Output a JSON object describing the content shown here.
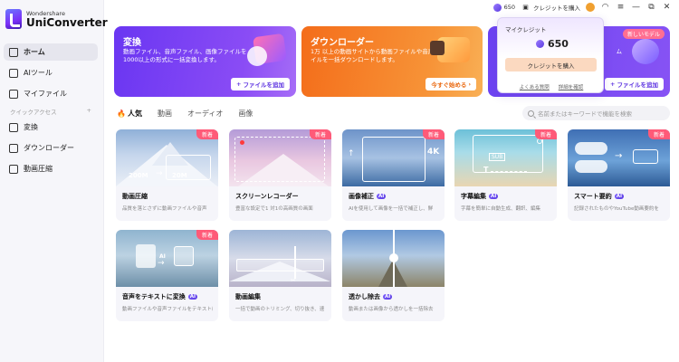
{
  "app": {
    "brand_small": "Wondershare",
    "brand_name": "UniConverter"
  },
  "sidebar": {
    "items": [
      {
        "label": "ホーム",
        "icon": "home-icon",
        "active": true
      },
      {
        "label": "AIツール",
        "icon": "ai-tools-icon"
      },
      {
        "label": "マイファイル",
        "icon": "my-files-icon"
      }
    ],
    "quick_access": "クイックアクセス",
    "quick_items": [
      {
        "label": "変換",
        "icon": "convert-icon"
      },
      {
        "label": "ダウンローダー",
        "icon": "downloader-icon"
      },
      {
        "label": "動画圧縮",
        "icon": "compress-icon"
      }
    ]
  },
  "titlebar": {
    "credits": "650",
    "buy_label": "クレジットを購入"
  },
  "banners": [
    {
      "title": "変換",
      "desc": "動画ファイル、音声ファイル、画像ファイルを1000以上の形式に一括変換します。",
      "button": "ファイルを追加"
    },
    {
      "title": "ダウンローダー",
      "desc": "1万 以上の動画サイトから動画ファイルや音声ファイルを一括ダウンロードします。",
      "button": "今すぐ始める"
    },
    {
      "title": "",
      "badge": "新しいモデル",
      "desc_tail": "ム",
      "button": "ファイルを追加"
    }
  ],
  "credit_popup": {
    "title": "マイクレジット",
    "value": "650",
    "buy_button": "クレジットを購入",
    "links": [
      "よくある質問",
      "詳細を確認"
    ]
  },
  "tabs": [
    "人気",
    "動画",
    "オーディオ",
    "画像"
  ],
  "search": {
    "placeholder": "名前またはキーワードで機能を検索"
  },
  "cards": [
    {
      "title": "動画圧縮",
      "desc": "品質を落とさずに動画ファイルや音声",
      "badge_new": "新着",
      "ai": false
    },
    {
      "title": "スクリーンレコーダー",
      "desc": "豊富な設定で1 対1の高画質の画面",
      "badge_new": "新着",
      "ai": false
    },
    {
      "title": "画像補正",
      "desc": "AIを使用して画像を一括で補正し、鮮",
      "badge_new": "新着",
      "ai": true
    },
    {
      "title": "字幕編集",
      "desc": "字幕を簡単に自動生成、翻訳、編集",
      "badge_new": "新着",
      "ai": true
    },
    {
      "title": "スマート要約",
      "desc": "記録されたものやYouTube動画要約を",
      "badge_new": "新着",
      "ai": true
    },
    {
      "title": "音声をテキストに変換",
      "desc": "動画ファイルや音声ファイルをテキストに",
      "badge_new": "新着",
      "ai": true
    },
    {
      "title": "動画編集",
      "desc": "一括で動画のトリミング、切り抜き、速",
      "badge_new": "",
      "ai": false
    },
    {
      "title": "透かし除去",
      "desc": "動画または画像から透かしを一括除去",
      "badge_new": "",
      "ai": true
    }
  ],
  "thumb_text": {
    "compress_from": "200M",
    "compress_to": "20M",
    "resolution": "4K",
    "sub": "SUB",
    "sub_t": "T",
    "ai": "AI"
  },
  "ai_label": "AI",
  "colors": {
    "accent": "#6a36f2",
    "orange": "#f46d1a",
    "new_badge": "#ff5a78"
  }
}
